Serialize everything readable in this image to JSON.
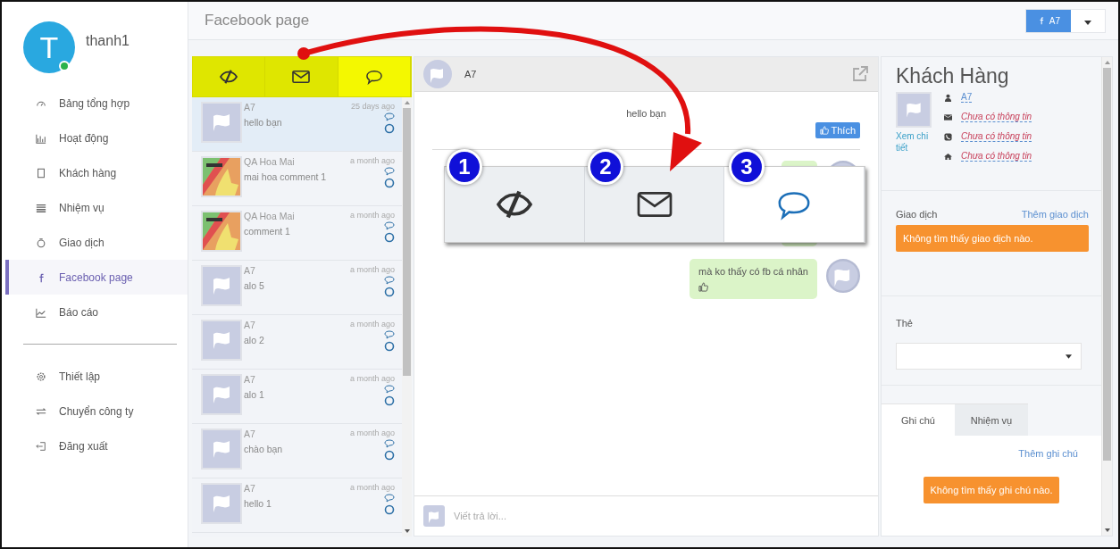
{
  "user": {
    "initial": "T",
    "name": "thanh1",
    "online": true
  },
  "nav": [
    {
      "label": "Bảng tổng hợp",
      "selected": false
    },
    {
      "label": "Hoạt động",
      "selected": false
    },
    {
      "label": "Khách hàng",
      "selected": false
    },
    {
      "label": "Nhiệm vụ",
      "selected": false
    },
    {
      "label": "Giao dịch",
      "selected": false
    },
    {
      "label": "Facebook page",
      "selected": true
    },
    {
      "label": "Báo cáo",
      "selected": false
    }
  ],
  "nav_bottom": [
    {
      "label": "Thiết lập"
    },
    {
      "label": "Chuyển công ty"
    },
    {
      "label": "Đăng xuất"
    }
  ],
  "header": {
    "title": "Facebook page",
    "page_button": "A7"
  },
  "filters": [
    {
      "kind": "eye-slash",
      "selected": false
    },
    {
      "kind": "envelope",
      "selected": false
    },
    {
      "kind": "comment",
      "selected": true
    }
  ],
  "conversations": [
    {
      "name": "A7",
      "message": "hello bạn",
      "time": "25 days ago",
      "kind": "flag",
      "selected": true
    },
    {
      "name": "QA Hoa Mai",
      "message": "mai hoa comment 1",
      "time": "a month ago",
      "kind": "picture",
      "selected": false
    },
    {
      "name": "QA Hoa Mai",
      "message": "comment 1",
      "time": "a month ago",
      "kind": "picture",
      "selected": false
    },
    {
      "name": "A7",
      "message": "alo 5",
      "time": "a month ago",
      "kind": "flag",
      "selected": false
    },
    {
      "name": "A7",
      "message": "alo 2",
      "time": "a month ago",
      "kind": "flag",
      "selected": false
    },
    {
      "name": "A7",
      "message": "alo 1",
      "time": "a month ago",
      "kind": "flag",
      "selected": false
    },
    {
      "name": "A7",
      "message": "chào bạn",
      "time": "a month ago",
      "kind": "flag",
      "selected": false
    },
    {
      "name": "A7",
      "message": "hello 1",
      "time": "a month ago",
      "kind": "flag",
      "selected": false
    }
  ],
  "chat": {
    "name": "A7",
    "messages": [
      {
        "kind": "incoming",
        "text": "hello bạn",
        "like_label": "Thích"
      },
      {
        "kind": "outgoing"
      },
      {
        "kind": "outgoing",
        "text": "mà ko thấy có fb cá nhân"
      }
    ],
    "reply_placeholder": "Viết trả lời..."
  },
  "callout": {
    "badges": [
      "1",
      "2",
      "3"
    ]
  },
  "customer": {
    "title": "Khách Hàng",
    "name": "A7",
    "view_link": "Xem chi tiết",
    "fields": [
      "Chưa có thông tin",
      "Chưa có thông tin",
      "Chưa có thông tin"
    ]
  },
  "deals": {
    "label": "Giao dịch",
    "add": "Thêm giao dịch",
    "empty": "Không tìm thấy giao dịch nào."
  },
  "tags": {
    "label": "Thẻ"
  },
  "note_tabs": [
    {
      "label": "Ghi chú",
      "selected": true
    },
    {
      "label": "Nhiệm vụ",
      "selected": false
    }
  ],
  "notes": {
    "add": "Thêm ghi chú",
    "empty": "Không tìm thấy ghi chú nào."
  }
}
